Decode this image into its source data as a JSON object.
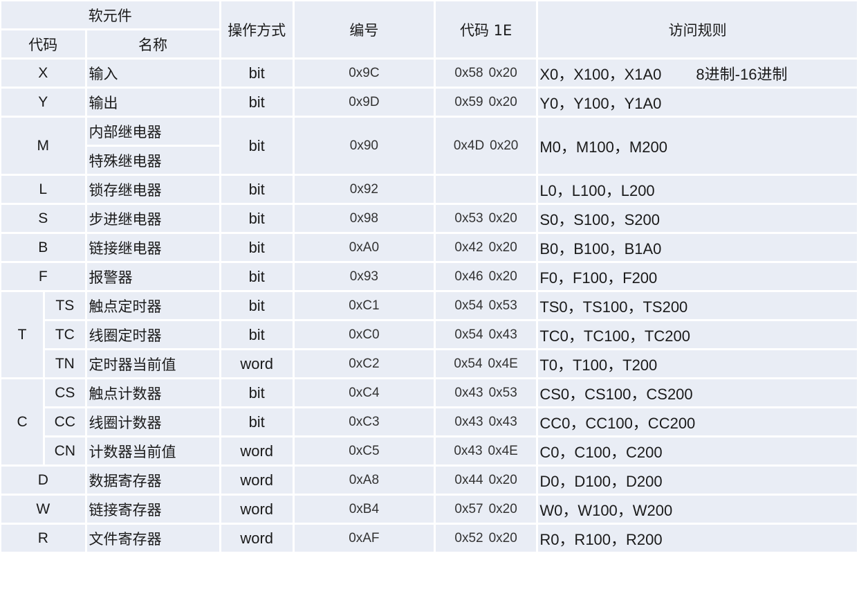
{
  "header": {
    "soft_element": "软元件",
    "code": "代码",
    "name": "名称",
    "operation": "操作方式",
    "number": "编号",
    "code_1e": "代码 1E",
    "access_rule": "访问规则"
  },
  "rows": [
    {
      "code": "X",
      "name": "输入",
      "op": "bit",
      "num": "0x9C",
      "c1": "0x58",
      "c2": "0x20",
      "rule": "X0，X100，X1A0",
      "note": "8进制-16进制"
    },
    {
      "code": "Y",
      "name": "输出",
      "op": "bit",
      "num": "0x9D",
      "c1": "0x59",
      "c2": "0x20",
      "rule": "Y0，Y100，Y1A0"
    },
    {
      "code": "M",
      "name1": "内部继电器",
      "name2": "特殊继电器",
      "op": "bit",
      "num": "0x90",
      "c1": "0x4D",
      "c2": "0x20",
      "rule": "M0，M100，M200"
    },
    {
      "code": "L",
      "name": "锁存继电器",
      "op": "bit",
      "num": "0x92",
      "c1": "",
      "c2": "",
      "rule": "L0，L100，L200"
    },
    {
      "code": "S",
      "name": "步进继电器",
      "op": "bit",
      "num": "0x98",
      "c1": "0x53",
      "c2": "0x20",
      "rule": "S0，S100，S200"
    },
    {
      "code": "B",
      "name": "链接继电器",
      "op": "bit",
      "num": "0xA0",
      "c1": "0x42",
      "c2": "0x20",
      "rule": "B0，B100，B1A0"
    },
    {
      "code": "F",
      "name": "报警器",
      "op": "bit",
      "num": "0x93",
      "c1": "0x46",
      "c2": "0x20",
      "rule": "F0，F100，F200"
    },
    {
      "group": "T",
      "code": "TS",
      "name": "触点定时器",
      "op": "bit",
      "num": "0xC1",
      "c1": "0x54",
      "c2": "0x53",
      "rule": "TS0，TS100，TS200"
    },
    {
      "code": "TC",
      "name": "线圈定时器",
      "op": "bit",
      "num": "0xC0",
      "c1": "0x54",
      "c2": "0x43",
      "rule": "TC0，TC100，TC200"
    },
    {
      "code": "TN",
      "name": "定时器当前值",
      "op": "word",
      "num": "0xC2",
      "c1": "0x54",
      "c2": "0x4E",
      "rule": "T0，T100，T200"
    },
    {
      "group": "C",
      "code": "CS",
      "name": "触点计数器",
      "op": "bit",
      "num": "0xC4",
      "c1": "0x43",
      "c2": "0x53",
      "rule": "CS0，CS100，CS200"
    },
    {
      "code": "CC",
      "name": "线圈计数器",
      "op": "bit",
      "num": "0xC3",
      "c1": "0x43",
      "c2": "0x43",
      "rule": "CC0，CC100，CC200"
    },
    {
      "code": "CN",
      "name": "计数器当前值",
      "op": "word",
      "num": "0xC5",
      "c1": "0x43",
      "c2": "0x4E",
      "rule": "C0，C100，C200"
    },
    {
      "code": "D",
      "name": "数据寄存器",
      "op": "word",
      "num": "0xA8",
      "c1": "0x44",
      "c2": "0x20",
      "rule": "D0，D100，D200"
    },
    {
      "code": "W",
      "name": "链接寄存器",
      "op": "word",
      "num": "0xB4",
      "c1": "0x57",
      "c2": "0x20",
      "rule": "W0，W100，W200"
    },
    {
      "code": "R",
      "name": "文件寄存器",
      "op": "word",
      "num": "0xAF",
      "c1": "0x52",
      "c2": "0x20",
      "rule": "R0，R100，R200"
    }
  ]
}
